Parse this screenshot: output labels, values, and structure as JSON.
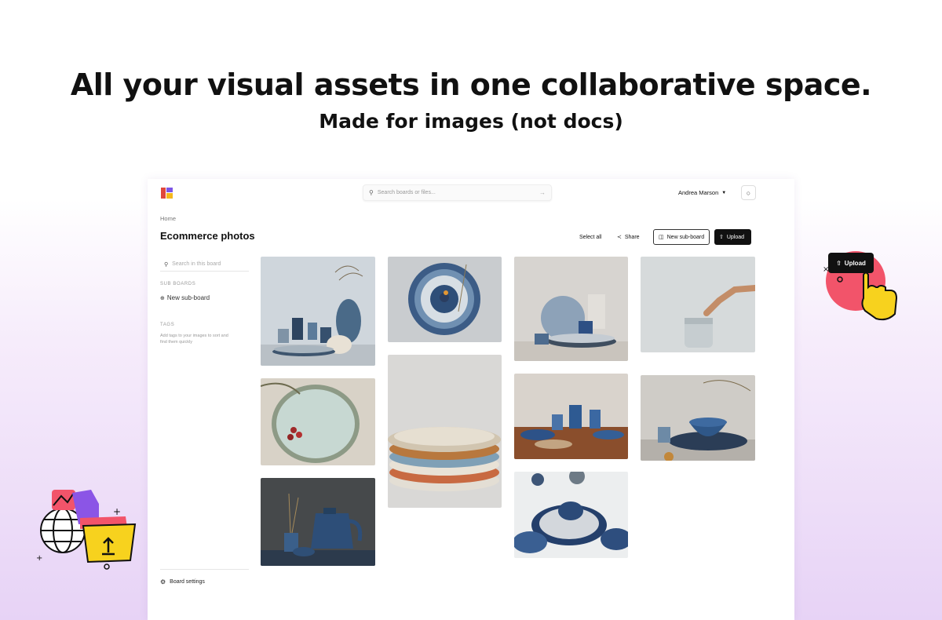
{
  "hero": {
    "title": "All your visual assets in one collaborative space.",
    "subtitle": "Made for images (not docs)"
  },
  "header": {
    "search_placeholder": "Search boards or files...",
    "user_name": "Andrea Marson"
  },
  "board": {
    "breadcrumb": "Home",
    "title": "Ecommerce photos"
  },
  "toolbar": {
    "select_all": "Select all",
    "share": "Share",
    "new_sub_board": "New sub-board",
    "upload": "Upload"
  },
  "sidebar": {
    "search_placeholder": "Search in this board",
    "sub_boards_heading": "SUB BOARDS",
    "new_sub_board": "New sub-board",
    "tags_heading": "TAGS",
    "tags_help": "Add tags to your images to sort and find them quickly",
    "board_settings": "Board settings"
  },
  "callout": {
    "upload_label": "Upload"
  },
  "colors": {
    "accent_red": "#f2546a",
    "accent_yellow": "#f7d21e",
    "accent_purple": "#8b55e6",
    "logo_red": "#e0473c",
    "logo_purple": "#7d55e6",
    "logo_yellow": "#f5b81c"
  },
  "icons": [
    "logo-icon",
    "search-icon",
    "arrow-right-icon",
    "chevron-down-icon",
    "bell-icon",
    "share-icon",
    "new-board-icon",
    "upload-icon",
    "plus-circle-icon",
    "gear-icon",
    "pointer-hand-icon",
    "globe-icon",
    "folder-upload-icon"
  ]
}
